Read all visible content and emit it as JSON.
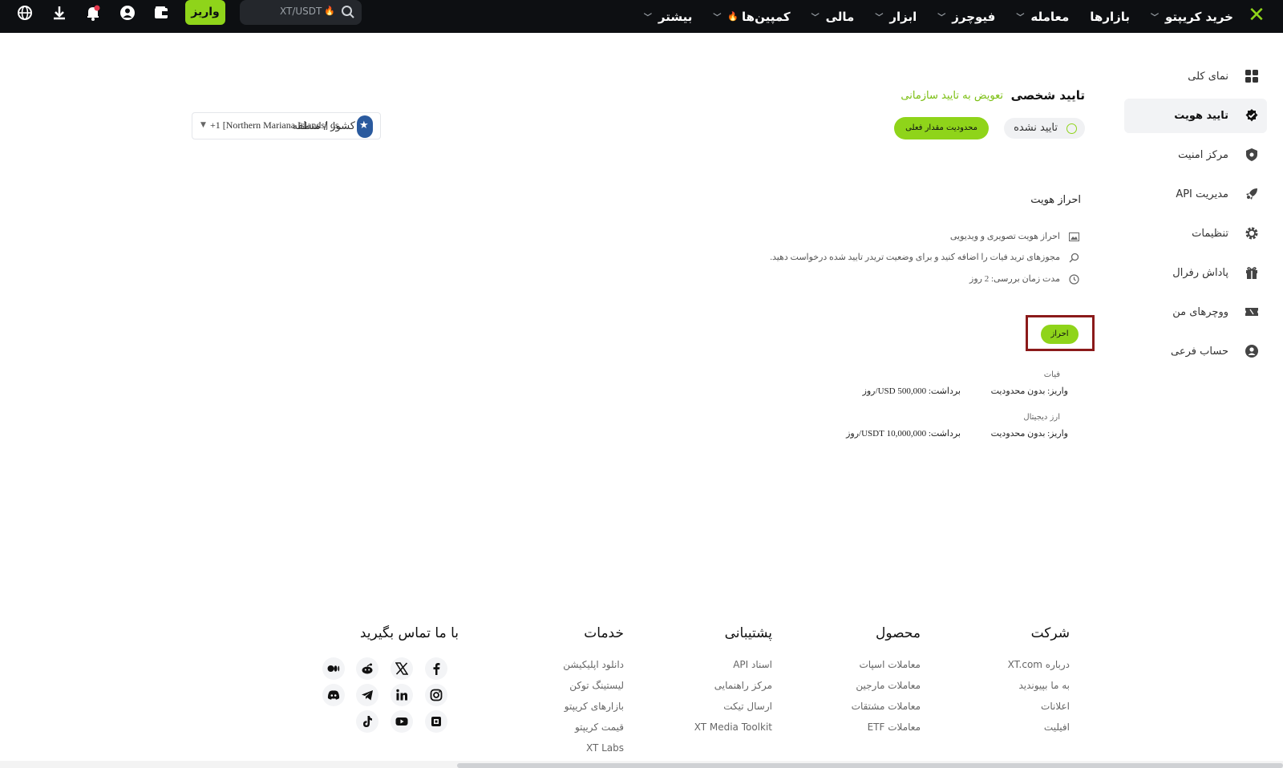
{
  "topbar": {
    "nav": [
      {
        "label": "خرید کریپتو",
        "has_menu": true
      },
      {
        "label": "بازارها",
        "has_menu": false
      },
      {
        "label": "معامله",
        "has_menu": true
      },
      {
        "label": "فیوچرز",
        "has_menu": true
      },
      {
        "label": "ابزار",
        "has_menu": true
      },
      {
        "label": "مالی",
        "has_menu": true
      },
      {
        "label": "کمپین‌ها",
        "has_menu": true
      },
      {
        "label": "بیشتر",
        "has_menu": true
      }
    ],
    "search_value": "XT/USDT",
    "deposit_label": "واریز",
    "icons": [
      "wallet-icon",
      "user-icon",
      "bell-icon",
      "download-icon",
      "globe-icon"
    ],
    "accent": "#8fd41a",
    "bg": "#0d0f12"
  },
  "sidebar": {
    "items": [
      {
        "label": "نمای کلی",
        "icon": "grid-icon",
        "active": false
      },
      {
        "label": "تایید هویت",
        "icon": "verified-badge-icon",
        "active": true
      },
      {
        "label": "مرکز امنیت",
        "icon": "shield-icon",
        "active": false
      },
      {
        "label": "مدیریت API",
        "icon": "rocket-icon",
        "active": false
      },
      {
        "label": "تنظیمات",
        "icon": "gear-icon",
        "active": false
      },
      {
        "label": "پاداش رفرال",
        "icon": "gift-icon",
        "active": false
      },
      {
        "label": "ووچرهای من",
        "icon": "ticket-icon",
        "active": false
      },
      {
        "label": "حساب فرعی",
        "icon": "sub-account-icon",
        "active": false
      }
    ]
  },
  "verification": {
    "title": "تایید شخصی",
    "switch_link": "تعویض به تایید سازمانی",
    "status": "تایید نشده",
    "limit_button": "محدودیت مقدار فعلی",
    "country_label": "کشور / منطقه",
    "country_value": "+1 [Northern Mariana Islands] ds...",
    "kyc_heading": "احراز هویت",
    "features": [
      {
        "text": "احراز هویت تصویری و ویدیویی",
        "icon": "image-icon"
      },
      {
        "text": "مجوزهای ترید فیات را اضافه کنید و برای وضعیت تریدر تایید شده درخواست دهید.",
        "icon": "search-icon"
      },
      {
        "text": "مدت زمان بررسی: 2 روز",
        "icon": "clock-icon"
      }
    ],
    "kyc_button": "احراز",
    "limits": [
      {
        "category": "فیات",
        "deposit": "واریز: بدون محدودیت",
        "withdraw": "برداشت: 500,000 USD/روز"
      },
      {
        "category": "ارز دیجیتال",
        "deposit": "واریز: بدون محدودیت",
        "withdraw": "برداشت: 10,000,000 USDT/روز"
      }
    ]
  },
  "footer": {
    "columns": [
      {
        "title": "شرکت",
        "links": [
          "درباره XT.com",
          "به ما بپیوندید",
          "اعلانات",
          "افیلیت"
        ]
      },
      {
        "title": "محصول",
        "links": [
          "معاملات اسپات",
          "معاملات مارجین",
          "معاملات مشتقات",
          "معاملات ETF"
        ]
      },
      {
        "title": "پشتیبانی",
        "links": [
          "اسناد API",
          "مرکز راهنمایی",
          "ارسال تیکت",
          "XT Media Toolkit"
        ]
      },
      {
        "title": "خدمات",
        "links": [
          "دانلود اپلیکیشن",
          "لیستینگ توکن",
          "بازارهای کریپتو",
          "قیمت کریپتو",
          "XT Labs"
        ]
      }
    ],
    "contact_title": "با ما تماس بگیرید",
    "socials": [
      "facebook-icon",
      "x-icon",
      "reddit-icon",
      "medium-icon",
      "instagram-icon",
      "linkedin-icon",
      "telegram-icon",
      "discord-icon",
      "coinmarketcap-icon",
      "youtube-icon",
      "tiktok-icon"
    ]
  }
}
